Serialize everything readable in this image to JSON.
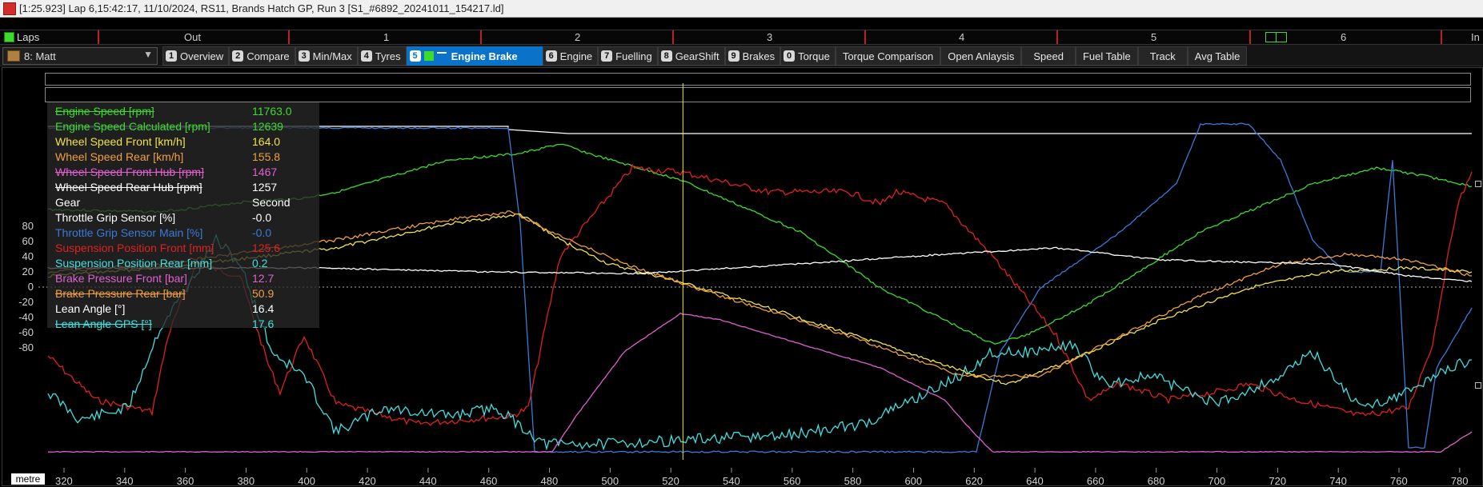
{
  "window": {
    "title": "[1:25.923] Lap 6,15:42:17, 11/10/2024,  RS11, Brands Hatch GP, Run 3 [S1_#6892_20241011_154217.ld]"
  },
  "laps_bar": {
    "label": "Laps",
    "laps": [
      "Out",
      "1",
      "2",
      "3",
      "4",
      "5",
      "6",
      "In"
    ]
  },
  "toolbar": {
    "driver": "8: Matt",
    "tabs": [
      {
        "num": "1",
        "label": "Overview"
      },
      {
        "num": "2",
        "label": "Compare"
      },
      {
        "num": "3",
        "label": "Min/Max"
      },
      {
        "num": "4",
        "label": "Tyres"
      },
      {
        "num": "5",
        "label": "Engine Brake",
        "active": true
      },
      {
        "num": "6",
        "label": "Engine"
      },
      {
        "num": "7",
        "label": "Fuelling"
      },
      {
        "num": "8",
        "label": "GearShift"
      },
      {
        "num": "9",
        "label": "Brakes"
      },
      {
        "num": "0",
        "label": "Torque"
      },
      {
        "num": "",
        "label": "Torque Comparison"
      },
      {
        "num": "",
        "label": "Open Anlaysis"
      },
      {
        "num": "",
        "label": "Speed"
      },
      {
        "num": "",
        "label": "Fuel Table"
      },
      {
        "num": "",
        "label": "Track"
      },
      {
        "num": "",
        "label": "Avg Table"
      }
    ]
  },
  "legend": [
    {
      "name": "Engine Speed [rpm]",
      "value": "11763.0",
      "color": "#3cdc2a",
      "strike": true
    },
    {
      "name": "Engine Speed Calculated [rpm]",
      "value": "12639",
      "color": "#3cdc2a",
      "strike": false
    },
    {
      "name": "Wheel Speed Front [km/h]",
      "value": "164.0",
      "color": "#f2e24a",
      "strike": false
    },
    {
      "name": "Wheel Speed Rear [km/h]",
      "value": "155.8",
      "color": "#f0a040",
      "strike": false
    },
    {
      "name": "Wheel Speed Front Hub [rpm]",
      "value": "1467",
      "color": "#e060d0",
      "strike": true
    },
    {
      "name": "Wheel Speed Rear Hub [rpm]",
      "value": "1257",
      "color": "#ffffff",
      "strike": true
    },
    {
      "name": "Gear",
      "value": "Second",
      "color": "#ffffff",
      "strike": false
    },
    {
      "name": "Throttle Grip Sensor [%]",
      "value": "-0.0",
      "color": "#ffffff",
      "strike": false
    },
    {
      "name": "Throttle Grip Sensor Main [%]",
      "value": "-0.0",
      "color": "#3a7ad8",
      "strike": false
    },
    {
      "name": "Suspension Position Front [mm]",
      "value": "125.6",
      "color": "#e02020",
      "strike": false
    },
    {
      "name": "Suspension Position Rear [mm]",
      "value": "0.2",
      "color": "#40e0e0",
      "strike": false
    },
    {
      "name": "Brake Pressure Front [bar]",
      "value": "12.7",
      "color": "#e060d0",
      "strike": false
    },
    {
      "name": "Brake Pressure Rear [bar]",
      "value": "50.9",
      "color": "#f0a040",
      "strike": true
    },
    {
      "name": "Lean Angle [°]",
      "value": "16.4",
      "color": "#ffffff",
      "strike": false
    },
    {
      "name": "Lean Angle GPS [°]",
      "value": "17.6",
      "color": "#40e0e0",
      "strike": true
    }
  ],
  "y_axis": [
    "80",
    "60",
    "40",
    "20",
    "0",
    "-20",
    "-40",
    "-60",
    "-80"
  ],
  "x_axis": {
    "unit": "metre",
    "ticks": [
      "320",
      "340",
      "360",
      "380",
      "400",
      "420",
      "440",
      "460",
      "480",
      "500",
      "520",
      "540",
      "560",
      "580",
      "600",
      "620",
      "640",
      "660",
      "680",
      "700",
      "720",
      "740",
      "760",
      "780"
    ]
  },
  "cursor": {
    "distance": 524
  },
  "colors": {
    "engine_speed": "#3cdc2a",
    "wheel_front": "#f2e24a",
    "wheel_rear": "#f0a040",
    "brake_front": "#e060d0",
    "throttle": "#3a7ad8",
    "susp_front": "#e02020",
    "susp_rear": "#40e0e0",
    "white": "#ffffff",
    "accent": "#0a73c9"
  }
}
